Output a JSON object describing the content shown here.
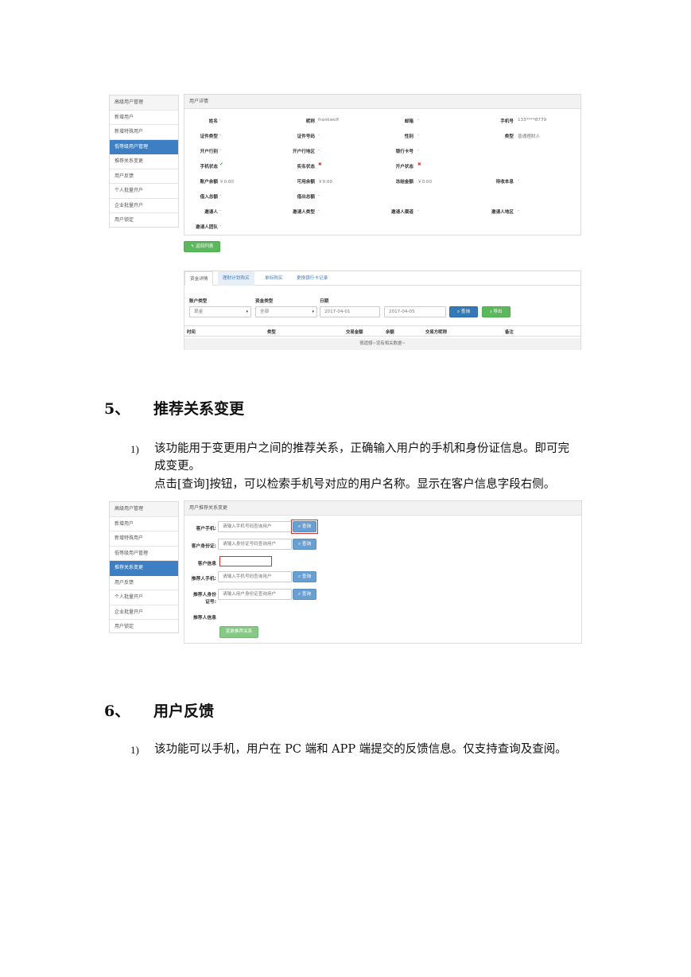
{
  "screenshot1": {
    "sidebar": [
      "高级用户管理",
      "新增用户",
      "新增特殊用户",
      "低等级用户管理",
      "推荐关系变更",
      "用户反馈",
      "个人批量开户",
      "企业批量开户",
      "用户锁定"
    ],
    "panel_title": "用户详情",
    "details": [
      {
        "label": "姓名",
        "value": "-"
      },
      {
        "label": "昵称",
        "value": "frankwolf"
      },
      {
        "label": "邮箱",
        "value": "-"
      },
      {
        "label": "手机号",
        "value": "133****8779"
      },
      {
        "label": "证件类型",
        "value": "-"
      },
      {
        "label": "证件号码",
        "value": "-"
      },
      {
        "label": "性别",
        "value": "-"
      },
      {
        "label": "类型",
        "value": "普通理财人"
      },
      {
        "label": "开户行别",
        "value": "-"
      },
      {
        "label": "开户行地区",
        "value": "-"
      },
      {
        "label": "银行卡号",
        "value": "-"
      },
      {
        "label": "手机状态",
        "value": "✔"
      },
      {
        "label": "实名状态",
        "value": "✖"
      },
      {
        "label": "开户状态",
        "value": "✖"
      },
      {
        "label": "账户余额",
        "value": "￥0.00"
      },
      {
        "label": "可用余额",
        "value": "￥0.00"
      },
      {
        "label": "冻结金额",
        "value": "￥0.00"
      },
      {
        "label": "待收本息",
        "value": "-"
      },
      {
        "label": "借入总额",
        "value": "-"
      },
      {
        "label": "借出总额",
        "value": "-"
      },
      {
        "label": "邀请人",
        "value": "-"
      },
      {
        "label": "邀请人类型",
        "value": "-"
      },
      {
        "label": "邀请人渠道",
        "value": "-"
      },
      {
        "label": "邀请人地区",
        "value": "-"
      },
      {
        "label": "邀请人团队",
        "value": "-"
      }
    ],
    "back_button": "返回列表",
    "tabs": [
      "资金详情",
      "理财计划购买",
      "单标购买",
      "更换银行卡记录"
    ],
    "filters": {
      "account_type_label": "账户类型",
      "account_type_value": "现金",
      "fund_type_label": "资金类型",
      "fund_type_value": "全部",
      "date_label": "日期",
      "date_from": "2017-04-01",
      "date_to": "2017-04-05",
      "query_button": "查询",
      "export_button": "导出"
    },
    "table_headers": [
      "时间",
      "类型",
      "交易金额",
      "余额",
      "交易方昵称",
      "备注"
    ],
    "empty_text": "很遗憾~没有相关数据~"
  },
  "section5": {
    "number": "5、",
    "title": "推荐关系变更",
    "item_number": "1)",
    "line1": "该功能用于变更用户之间的推荐关系，正确输入用户的手机和身份证信息。即可完",
    "line2": "成变更。",
    "line3": "点击[查询]按钮，可以检索手机号对应的用户名称。显示在客户信息字段右侧。"
  },
  "screenshot2": {
    "sidebar": [
      "高级用户管理",
      "新增用户",
      "新增特殊用户",
      "低等级用户管理",
      "推荐关系变更",
      "用户反馈",
      "个人批量开户",
      "企业批量开户",
      "用户锁定"
    ],
    "panel_title": "用户推荐关系变更",
    "fields": [
      {
        "label": "客户手机:",
        "placeholder": "请输入手机号码查询用户",
        "button": "查询"
      },
      {
        "label": "客户身份证:",
        "placeholder": "请输入身份证号码查询用户",
        "button": "查询"
      },
      {
        "label": "客户信息"
      },
      {
        "label": "推荐人手机:",
        "placeholder": "请输入手机号码查询用户",
        "button": "查询"
      },
      {
        "label_line1": "推荐人身份",
        "label_line2": "证号:",
        "placeholder": "请输入用户身份证查询用户",
        "button": "查询"
      },
      {
        "label": "推荐人信息"
      }
    ],
    "submit_button": "变更推荐关系"
  },
  "section6": {
    "number": "6、",
    "title": "用户反馈",
    "item_number": "1)",
    "line1": "该功能可以手机，用户在 PC 端和 APP 端提交的反馈信息。仅支持查询及查阅。"
  }
}
